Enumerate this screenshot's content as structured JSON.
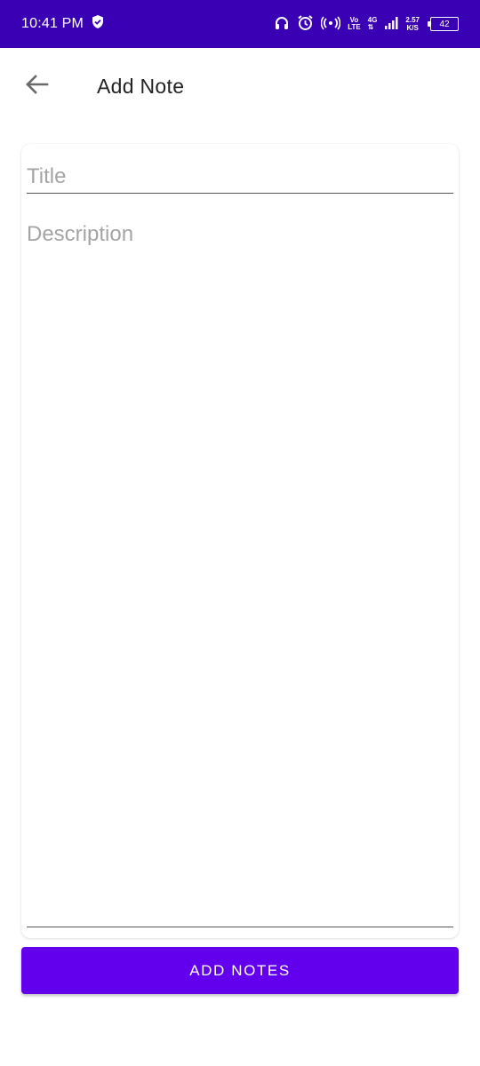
{
  "status_bar": {
    "time": "10:41 PM",
    "volte_top": "Vo",
    "volte_bottom": "LTE",
    "network": "4G",
    "net_speed_value": "2.57",
    "net_speed_unit": "K/S",
    "battery": "42",
    "background_color": "#3a00b3"
  },
  "app_bar": {
    "title": "Add Note",
    "back_icon": "arrow-left-icon"
  },
  "form": {
    "title_placeholder": "Title",
    "title_value": "",
    "description_placeholder": "Description",
    "description_value": ""
  },
  "actions": {
    "add_label": "ADD NOTES",
    "button_color": "#6200ee"
  }
}
